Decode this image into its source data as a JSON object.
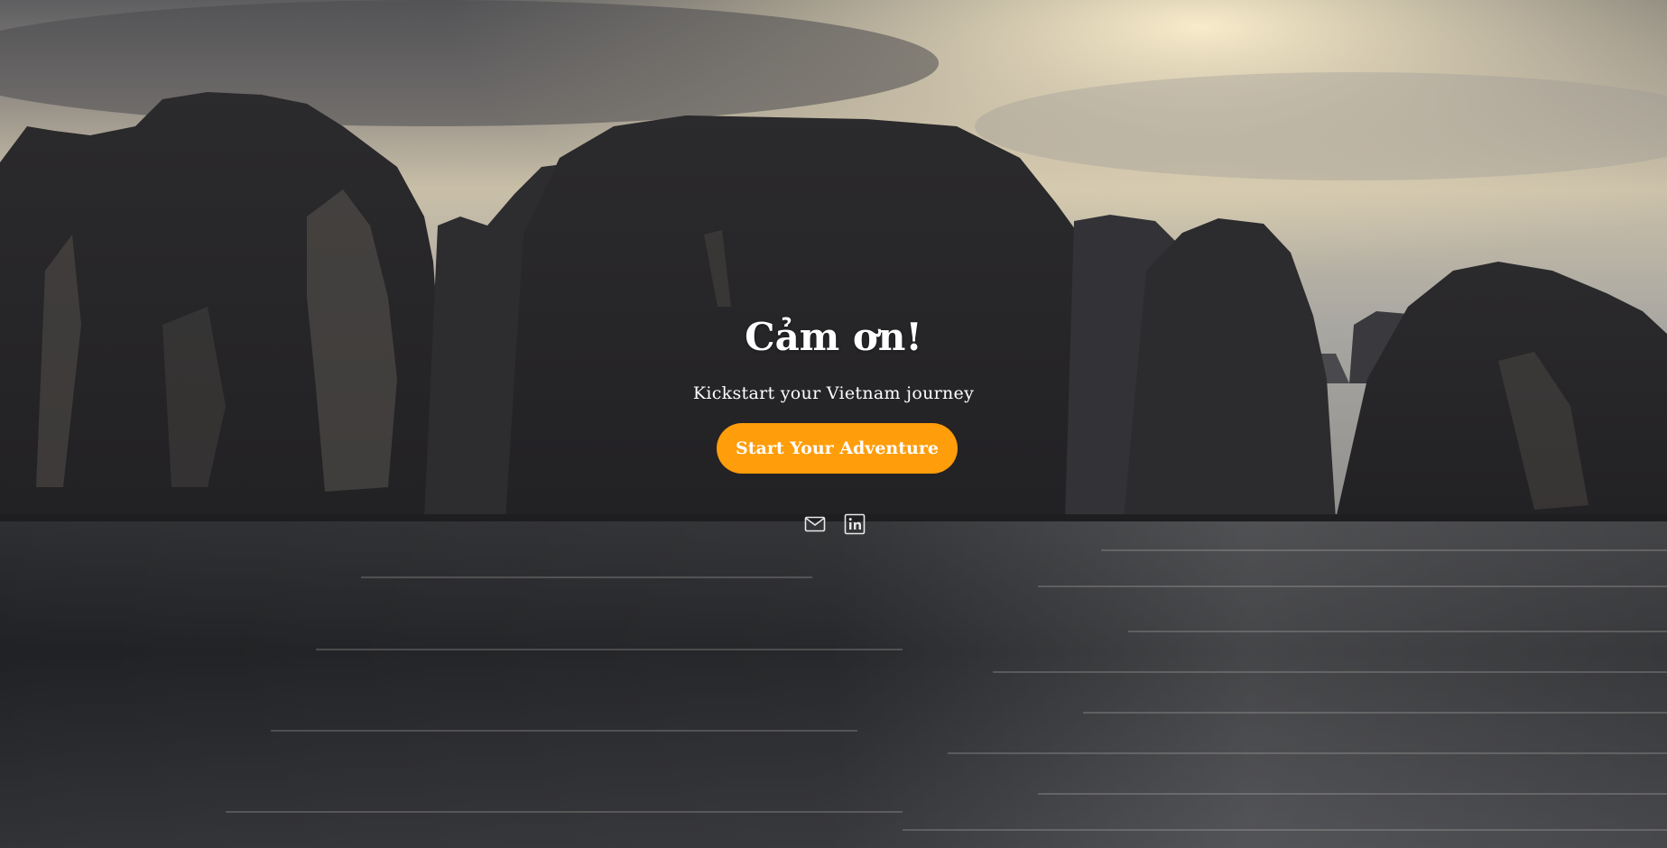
{
  "hero": {
    "title": "Cảm ơn!",
    "subtitle": "Kickstart your Vietnam journey",
    "cta_label": "Start Your Adventure",
    "background_description_icon": "landscape-photo"
  },
  "social": {
    "items": [
      {
        "icon": "mail-icon"
      },
      {
        "icon": "linkedin-icon"
      }
    ]
  },
  "colors": {
    "accent": "#ff9d0a",
    "text": "#ffffff"
  }
}
